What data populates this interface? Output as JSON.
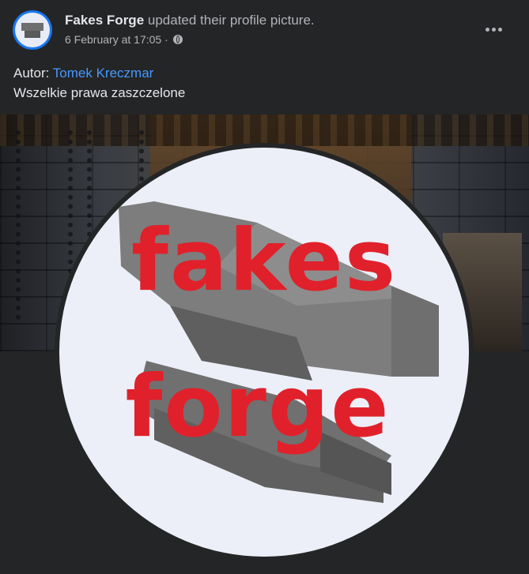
{
  "post": {
    "page_name": "Fakes Forge",
    "action": " updated their profile picture.",
    "date": "6 February at 17:05",
    "separator": " · ",
    "audience_icon": "globe-icon",
    "more_icon": "more-options-icon"
  },
  "body": {
    "author_label": "Autor: ",
    "author_name": "Tomek Kreczmar",
    "rights_line": "Wszelkie prawa zaszczelone"
  },
  "profile_picture": {
    "logo_line_1": "fakes",
    "logo_line_2": "forge",
    "logo_color": "#e0212b"
  },
  "colors": {
    "background": "#242526",
    "link": "#4599ff",
    "avatar_ring": "#1877f2",
    "secondary_text": "#b0b3b8"
  }
}
